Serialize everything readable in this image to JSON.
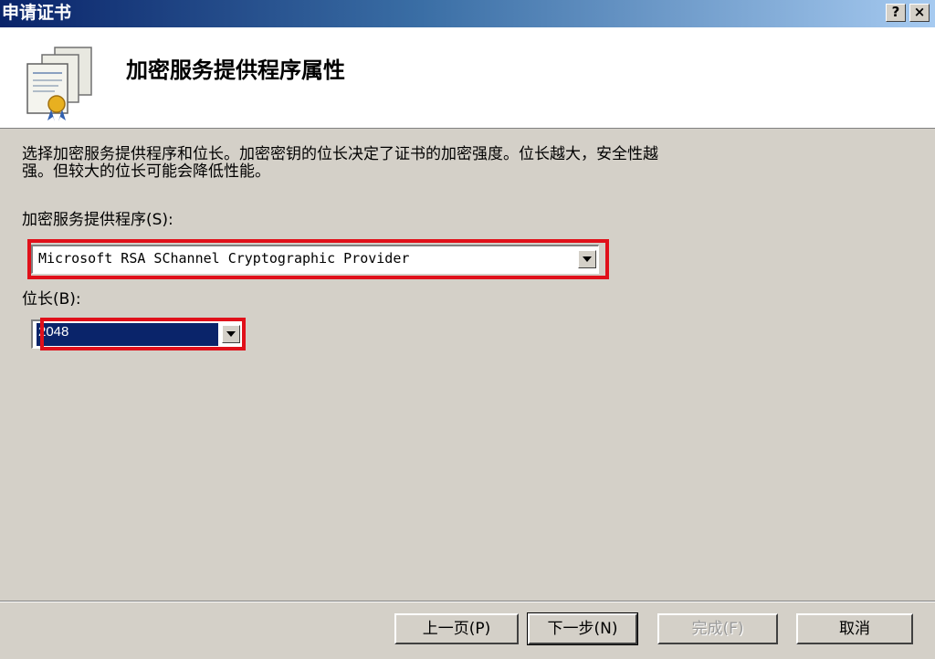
{
  "window": {
    "title": "申请证书",
    "help_label": "?",
    "close_label": "×"
  },
  "header": {
    "icon": "certificate-icon",
    "title": "加密服务提供程序属性"
  },
  "description_line1": "选择加密服务提供程序和位长。加密密钥的位长决定了证书的加密强度。位长越大，安全性越",
  "description_line2": "强。但较大的位长可能会降低性能。",
  "provider": {
    "label": "加密服务提供程序(S):",
    "value": "Microsoft RSA SChannel Cryptographic Provider"
  },
  "bit_length": {
    "label": "位长(B):",
    "value": "2048"
  },
  "buttons": {
    "back": "上一页(P)",
    "next": "下一步(N)",
    "finish": "完成(F)",
    "cancel": "取消"
  },
  "colors": {
    "highlight": "#e0101a",
    "selection": "#0a246a",
    "dialog": "#d4d0c8"
  }
}
